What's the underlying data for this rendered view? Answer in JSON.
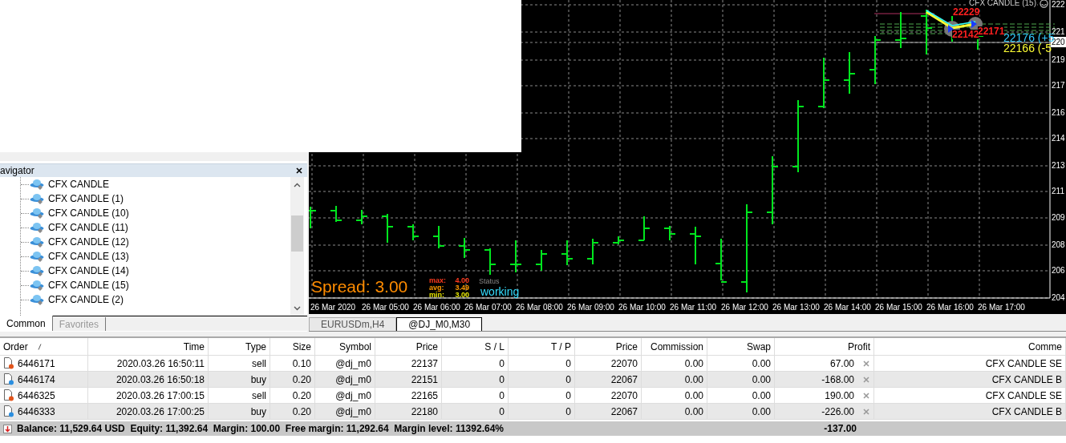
{
  "navigator": {
    "title": "avigator",
    "items": [
      "CFX CANDLE",
      "CFX CANDLE (1)",
      "CFX CANDLE (10)",
      "CFX CANDLE (11)",
      "CFX CANDLE (12)",
      "CFX CANDLE (13)",
      "CFX CANDLE (14)",
      "CFX CANDLE (15)",
      "CFX CANDLE (2)"
    ],
    "tabs": [
      {
        "label": "Common",
        "selected": true
      },
      {
        "label": "Favorites",
        "selected": false
      }
    ]
  },
  "chart": {
    "title": "CFX CANDLE (15)",
    "spread": "Spread: 3.00",
    "spread_stats": [
      {
        "label": "max:",
        "value": "4.00",
        "color": "#ff3a1e"
      },
      {
        "label": "avg:",
        "value": "3.49",
        "color": "#ff9a00"
      },
      {
        "label": "min:",
        "value": "3.00",
        "color": "#e6e600"
      }
    ],
    "status_label": "Status",
    "status": "working",
    "price_marks": [
      {
        "text": "22229",
        "color": "#ff2020"
      },
      {
        "text": "22142",
        "color": "#ff2020"
      },
      {
        "text": "22171",
        "color": "#ff2020"
      },
      {
        "text": "22176 (+5",
        "color": "#33ccff"
      },
      {
        "text": "22166 (-5",
        "color": "#ffff33"
      }
    ],
    "price_axis": [
      {
        "text": "222",
        "current": false
      },
      {
        "text": "221",
        "current": false
      },
      {
        "text": "220",
        "current": true
      },
      {
        "text": "219",
        "current": false
      },
      {
        "text": "217",
        "current": false
      },
      {
        "text": "216",
        "current": false
      },
      {
        "text": "214",
        "current": false
      },
      {
        "text": "213",
        "current": false
      },
      {
        "text": "211",
        "current": false
      },
      {
        "text": "209",
        "current": false
      },
      {
        "text": "208",
        "current": false
      },
      {
        "text": "206",
        "current": false
      },
      {
        "text": "204",
        "current": false
      }
    ],
    "time_axis": [
      "26 Mar 2020",
      "26 Mar 05:00",
      "26 Mar 06:00",
      "26 Mar 07:00",
      "26 Mar 08:00",
      "26 Mar 09:00",
      "26 Mar 10:00",
      "26 Mar 11:00",
      "26 Mar 12:00",
      "26 Mar 13:00",
      "26 Mar 14:00",
      "26 Mar 15:00",
      "26 Mar 16:00",
      "26 Mar 17:00"
    ]
  },
  "chart_tabs": [
    {
      "label": "EURUSDm,H4",
      "selected": false
    },
    {
      "label": "@DJ_M0,M30",
      "selected": true
    }
  ],
  "table": {
    "columns": [
      "Order",
      "Time",
      "Type",
      "Size",
      "Symbol",
      "Price",
      "S / L",
      "T / P",
      "Price",
      "Commission",
      "Swap",
      "Profit",
      "Comme"
    ],
    "rows": [
      {
        "kind": "sell",
        "cells": [
          "6446171",
          "2020.03.26 16:50:11",
          "sell",
          "0.10",
          "@dj_m0",
          "22137",
          "0",
          "0",
          "22070",
          "0.00",
          "0.00",
          "67.00",
          "CFX CANDLE SE"
        ]
      },
      {
        "kind": "buy",
        "cells": [
          "6446174",
          "2020.03.26 16:50:18",
          "buy",
          "0.20",
          "@dj_m0",
          "22151",
          "0",
          "0",
          "22067",
          "0.00",
          "0.00",
          "-168.00",
          "CFX CANDLE B"
        ]
      },
      {
        "kind": "sell",
        "cells": [
          "6446325",
          "2020.03.26 17:00:15",
          "sell",
          "0.20",
          "@dj_m0",
          "22165",
          "0",
          "0",
          "22070",
          "0.00",
          "0.00",
          "190.00",
          "CFX CANDLE SE"
        ]
      },
      {
        "kind": "buy",
        "cells": [
          "6446333",
          "2020.03.26 17:00:25",
          "buy",
          "0.20",
          "@dj_m0",
          "22180",
          "0",
          "0",
          "22067",
          "0.00",
          "0.00",
          "-226.00",
          "CFX CANDLE B"
        ]
      }
    ],
    "summary": {
      "text": "Balance: 11,529.64 USD  Equity: 11,392.64  Margin: 100.00  Free margin: 11,292.64  Margin level: 11392.64%",
      "profit": "-137.00"
    }
  }
}
